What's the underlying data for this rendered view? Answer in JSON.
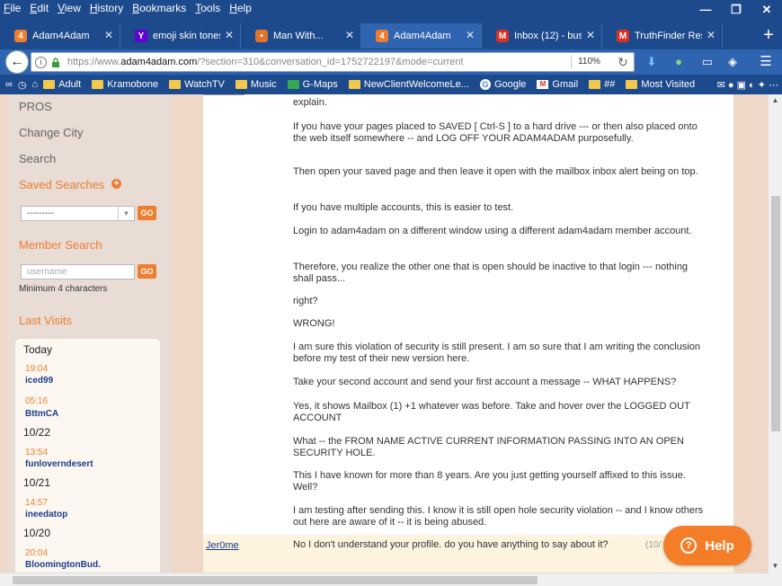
{
  "menu": [
    "File",
    "Edit",
    "View",
    "History",
    "Bookmarks",
    "Tools",
    "Help"
  ],
  "window_controls": {
    "minimize": "—",
    "maximize": "❐",
    "close": "✕"
  },
  "tabs": [
    {
      "label": "Adam4Adam",
      "fav_color": "#ef7d2e",
      "fav_glyph": "4"
    },
    {
      "label": "emoji skin tones...",
      "fav_color": "#6001d2",
      "fav_glyph": "Y"
    },
    {
      "label": "Man With...",
      "fav_color": "#e0742a",
      "fav_glyph": "•"
    },
    {
      "label": "Adam4Adam",
      "fav_color": "#ef7d2e",
      "fav_glyph": "4"
    },
    {
      "label": "Inbox (12) - bust...",
      "fav_color": "#d93025",
      "fav_glyph": "M"
    },
    {
      "label": "TruthFinder Res...",
      "fav_color": "#d93025",
      "fav_glyph": "M"
    }
  ],
  "new_tab": "+",
  "url": {
    "prefix": "https://www.",
    "domain": "adam4adam.com",
    "rest": "/?section=310&conversation_id=1752722197&mode=current"
  },
  "zoom": "110%",
  "bookmarks": [
    {
      "label": "Adult",
      "type": "folder"
    },
    {
      "label": "Kramobone",
      "type": "folder"
    },
    {
      "label": "WatchTV",
      "type": "folder"
    },
    {
      "label": "Music",
      "type": "folder"
    },
    {
      "label": "G-Maps",
      "type": "folder"
    },
    {
      "label": "NewClientWelcomeLe...",
      "type": "folder"
    },
    {
      "label": "Google",
      "type": "google"
    },
    {
      "label": "Gmail",
      "type": "gmail"
    },
    {
      "label": "##",
      "type": "folder"
    },
    {
      "label": "Most Visited",
      "type": "folder"
    }
  ],
  "sidebar": {
    "pros": "PROS",
    "change_city": "Change City",
    "search": "Search",
    "saved_searches": "Saved Searches",
    "saved_select": "---------",
    "go": "GO",
    "member_search": "Member Search",
    "username_placeholder": "username",
    "min_chars": "Minimum 4 characters",
    "last_visits": "Last Visits",
    "visits": [
      {
        "day": "Today",
        "time": "19:04",
        "user": "iced99"
      },
      {
        "time": "05:16",
        "user": "BttmCA"
      },
      {
        "day": "10/22",
        "time": "13:54",
        "user": "funloverndesert"
      },
      {
        "day": "10/21",
        "time": "14:57",
        "user": "ineedatop"
      },
      {
        "day": "10/20",
        "time": "20:04",
        "user": "BloomingtonBud."
      }
    ]
  },
  "message": {
    "paragraphs": [
      "explain.",
      "If you have your pages placed to SAVED [ Ctrl-S ] to a hard drive --- or then also placed onto the web itself somewhere -- and LOG OFF YOUR ADAM4ADAM purposefully.",
      "Then open your saved page and then leave it open with the mailbox inbox alert being on top.",
      "If you have multiple accounts, this is easier to test.",
      "Login to adam4adam on a different window using a different adam4adam member account.",
      "Therefore, you realize the other one that is open should be inactive to that login --- nothing shall pass...",
      "right?",
      "WRONG!",
      "I am sure this violation of security is still present. I am so sure that I am writing the conclusion before my test of their new version here.",
      "Take your second account and send your first account a message -- WHAT HAPPENS?",
      "Yes, it shows Mailbox (1) +1 whatever was before. Take and hover over the LOGGED OUT ACCOUNT",
      "What -- the FROM NAME ACTIVE CURRENT INFORMATION PASSING INTO AN OPEN SECURITY HOLE.",
      "This I have known for more than 8 years. Are you just getting yourself affixed to this issue. Well?",
      "I am testing after sending this. I know it is still open hole security violation -- and I know others out here are aware of it -- it is being abused."
    ]
  },
  "reply": {
    "user": "Jer0me",
    "text": "No I don't understand your profile. do you have anything to say about it?",
    "date": "(10/"
  },
  "help_button": "Help",
  "colors": {
    "chrome": "#1d4a8c",
    "accent": "#ef7d2e",
    "link": "#1c3e8a"
  }
}
